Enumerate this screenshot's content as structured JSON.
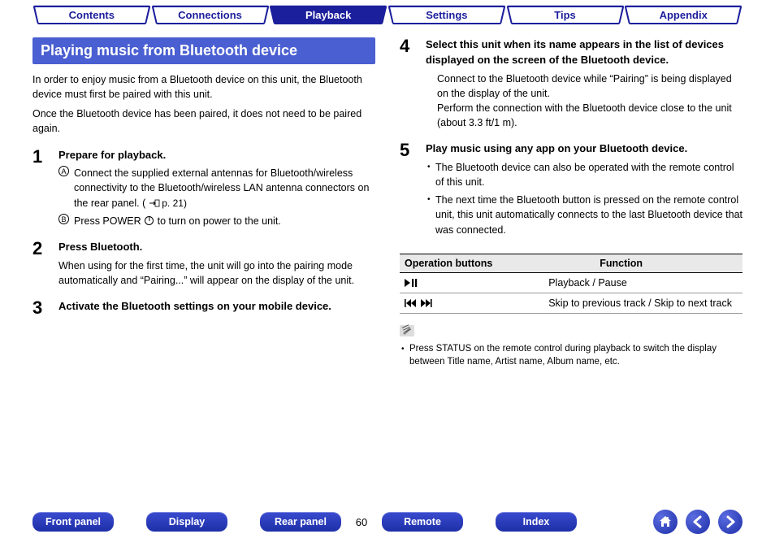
{
  "top_tabs": [
    {
      "label": "Contents",
      "active": false
    },
    {
      "label": "Connections",
      "active": false
    },
    {
      "label": "Playback",
      "active": true
    },
    {
      "label": "Settings",
      "active": false
    },
    {
      "label": "Tips",
      "active": false
    },
    {
      "label": "Appendix",
      "active": false
    }
  ],
  "title": "Playing music from Bluetooth device",
  "intro1": "In order to enjoy music from a Bluetooth device on this unit, the Bluetooth device must first be paired with this unit.",
  "intro2": "Once the Bluetooth device has been paired, it does not need to be paired again.",
  "steps": {
    "s1": {
      "num": "1",
      "title": "Prepare for playback.",
      "a_num": "A",
      "a_text": "Connect the supplied external antennas for Bluetooth/wireless connectivity to the Bluetooth/wireless LAN antenna connectors on the rear panel.  (",
      "a_ref": "p. 21)",
      "b_num": "B",
      "b_text_1": "Press POWER ",
      "b_text_2": " to turn on power to the unit."
    },
    "s2": {
      "num": "2",
      "title": "Press Bluetooth.",
      "body": "When using for the first time, the unit will go into the pairing mode automatically and “Pairing...” will appear on the display of the unit."
    },
    "s3": {
      "num": "3",
      "title": "Activate the Bluetooth settings on your mobile device."
    },
    "s4": {
      "num": "4",
      "title": "Select this unit when its name appears in the list of devices displayed on the screen of the Bluetooth device.",
      "body1": "Connect to the Bluetooth device while “Pairing” is being displayed on the display of the unit.",
      "body2": "Perform the connection with the Bluetooth device close to the unit (about 3.3 ft/1 m)."
    },
    "s5": {
      "num": "5",
      "title": "Play music using any app on your Bluetooth device.",
      "bul1": "The Bluetooth device can also be operated with the remote control of this unit.",
      "bul2": "The next time the Bluetooth button is pressed on the remote control unit, this unit automatically connects to the last Bluetooth device that was connected."
    }
  },
  "table": {
    "h1": "Operation buttons",
    "h2": "Function",
    "rows": [
      {
        "icon": "▶❘❘",
        "fn": "Playback / Pause"
      },
      {
        "icon": "⏮ ⏭",
        "fn": "Skip to previous track / Skip to next track"
      }
    ]
  },
  "note": "Press STATUS on the remote control during playback to switch the display between Title name, Artist name, Album name, etc.",
  "bottom": {
    "front": "Front panel",
    "display": "Display",
    "rear": "Rear panel",
    "page": "60",
    "remote": "Remote",
    "index": "Index"
  }
}
